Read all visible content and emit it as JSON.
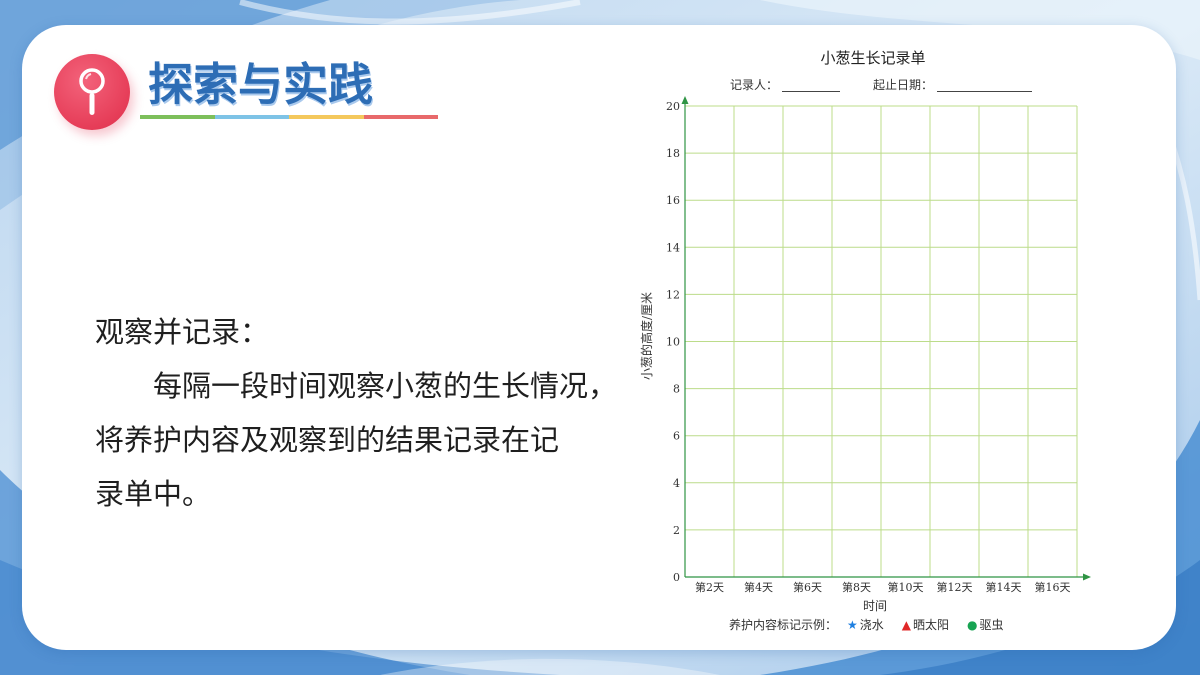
{
  "slide": {
    "title": "探索与实践",
    "title_icon": "magnifier-icon"
  },
  "body": {
    "label": "观察并记录：",
    "lines": [
      "每隔一段时间观察小葱的生长情况，",
      "将养护内容及观察到的结果记录在记",
      "录单中。"
    ]
  },
  "record_sheet": {
    "recorder_label": "记录人：",
    "date_label": "起止日期："
  },
  "chart_data": {
    "title": "小葱生长记录单",
    "xlabel": "时间",
    "ylabel": "小葱的高度/厘米",
    "categories": [
      "第2天",
      "第4天",
      "第6天",
      "第8天",
      "第10天",
      "第12天",
      "第14天",
      "第16天"
    ],
    "yticks": [
      0,
      2,
      4,
      6,
      8,
      10,
      12,
      14,
      16,
      18,
      20
    ],
    "ylim": [
      0,
      20
    ],
    "grid": true
  },
  "legend": {
    "label": "养护内容标记示例：",
    "items": [
      {
        "icon": "star-icon",
        "symbol": "★",
        "text": "浇水",
        "color": "#1e7fe0"
      },
      {
        "icon": "triangle-icon",
        "symbol": "▲",
        "text": "晒太阳",
        "color": "#e02828"
      },
      {
        "icon": "circle-icon",
        "symbol": "●",
        "text": "驱虫",
        "color": "#17a352"
      }
    ]
  },
  "colors": {
    "title": "#2d6db5",
    "icon_badge": "#e63d58",
    "underline": [
      "#7dbf5b",
      "#7ec3e6",
      "#f4c85c",
      "#e8696b"
    ],
    "chart_grid": "#bcdc8a",
    "chart_axis": "#2f9444",
    "background": "#c9dff2"
  }
}
